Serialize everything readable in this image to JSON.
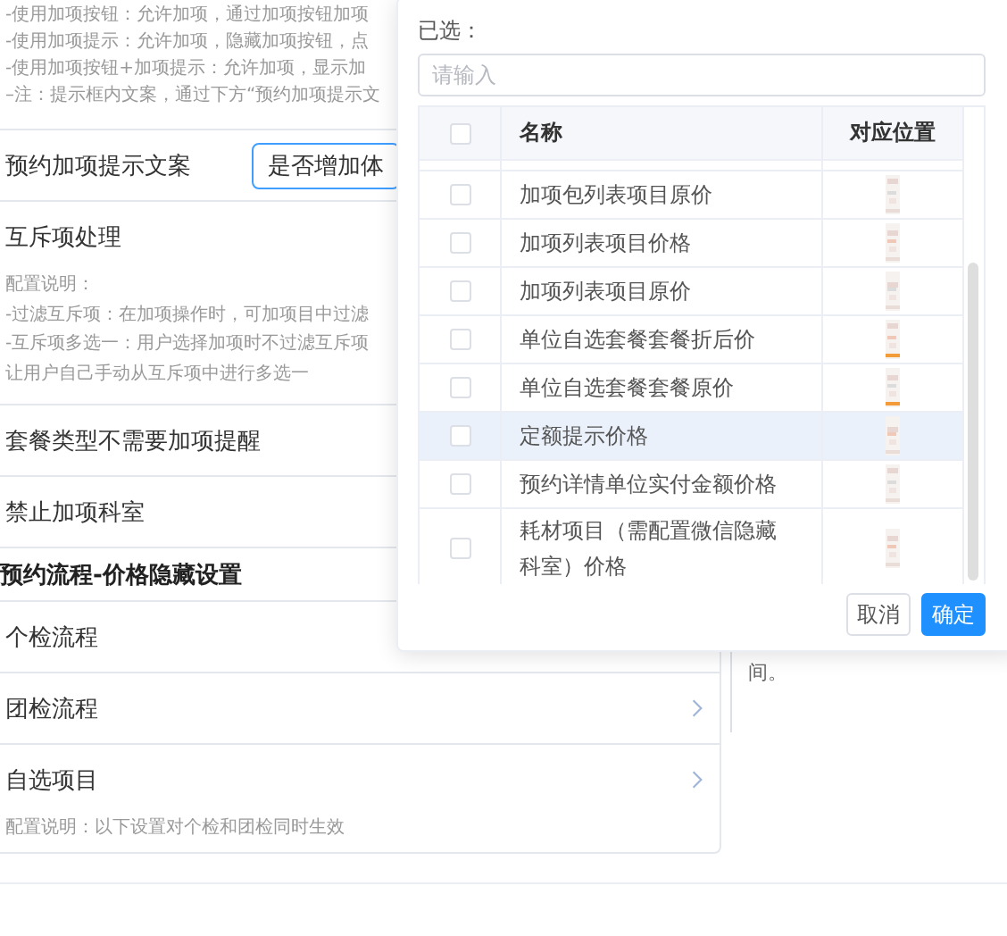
{
  "settings": {
    "top_notes": [
      "-使用加项按钮：允许加项，通过加项按钮加项",
      "-使用加项提示：允许加项，隐藏加项按钮，点",
      "-使用加项按钮+加项提示：允许加项，显示加",
      "–注：提示框内文案，通过下方“预约加项提示文"
    ],
    "rows": [
      {
        "kind": "input",
        "label": "预约加项提示文案",
        "value": "是否增加体"
      },
      {
        "kind": "plain",
        "label": "互斥项处理",
        "notes": [
          "配置说明：",
          "-过滤互斥项：在加项操作时，可加项目中过滤",
          "-互斥项多选一：用户选择加项时不过滤互斥项",
          "让用户自己手动从互斥项中进行多选一"
        ]
      },
      {
        "kind": "plain",
        "label": "套餐类型不需要加项提醒"
      },
      {
        "kind": "plain",
        "label": "禁止加项科室"
      },
      {
        "kind": "heading",
        "label": "预约流程-价格隐藏设置"
      },
      {
        "kind": "plain",
        "label": "个检流程"
      },
      {
        "kind": "link",
        "label": "团检流程"
      },
      {
        "kind": "link",
        "label": "自选项目",
        "notes": [
          "配置说明：以下设置对个检和团检同时生效"
        ]
      }
    ]
  },
  "side_text": "间。",
  "popover": {
    "title": "已选：",
    "search": {
      "placeholder": "请输入"
    },
    "columns": [
      "名称",
      "对应位置"
    ],
    "header_checked": false,
    "rows": [
      {
        "name": "加项包列表项目原价",
        "checked": false,
        "hovered": false
      },
      {
        "name": "加项列表项目价格",
        "checked": false,
        "hovered": false
      },
      {
        "name": "加项列表项目原价",
        "checked": false,
        "hovered": false
      },
      {
        "name": "单位自选套餐套餐折后价",
        "checked": false,
        "hovered": false
      },
      {
        "name": "单位自选套餐套餐原价",
        "checked": false,
        "hovered": false
      },
      {
        "name": "定额提示价格",
        "checked": false,
        "hovered": true
      },
      {
        "name": "预约详情单位实付金额价格",
        "checked": false,
        "hovered": false
      },
      {
        "name": "耗材项目（需配置微信隐藏科室）价格",
        "checked": false,
        "hovered": false
      }
    ],
    "buttons": [
      {
        "label": "取消",
        "kind": "default"
      },
      {
        "label": "确定",
        "kind": "primary"
      }
    ]
  }
}
